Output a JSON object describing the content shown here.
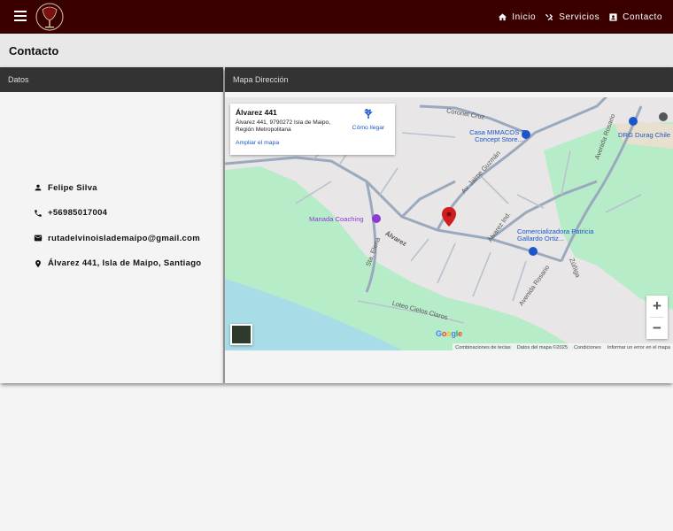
{
  "header": {
    "logo_name": "ruta-del-vino-logo",
    "nav": [
      {
        "label": "Inicio",
        "icon": "home-icon"
      },
      {
        "label": "Servicios",
        "icon": "tools-icon"
      },
      {
        "label": "Contacto",
        "icon": "contact-card-icon"
      }
    ]
  },
  "page": {
    "title": "Contacto"
  },
  "left_panel": {
    "title": "Datos",
    "contacts": [
      {
        "icon": "person-icon",
        "text": "Felipe Silva"
      },
      {
        "icon": "phone-icon",
        "text": "+56985017004"
      },
      {
        "icon": "email-icon",
        "text": "rutadelvinoislademaipo@gmail.com"
      },
      {
        "icon": "location-pin-icon",
        "text": "Álvarez 441, Isla de Maipo, Santiago"
      }
    ]
  },
  "right_panel": {
    "title": "Mapa Dirección",
    "map": {
      "info_title": "Álvarez 441",
      "info_address": "Álvarez 441, 9790272 Isla de Maipo, Región Metropolitana",
      "enlarge_link": "Ampliar el mapa",
      "directions_label": "Cómo llegar",
      "zoom_in": "+",
      "zoom_out": "−",
      "google": "Google",
      "attribution": [
        "Combinaciones de teclas",
        "Datos del mapa ©2025",
        "Condiciones",
        "Informar un error en el mapa"
      ],
      "street_labels": [
        "Coronel Cruz",
        "Av. Jaime Guzmán",
        "Álvarez Ind.",
        "Álvarez",
        "Sta. Elena",
        "Avenida Rosario",
        "Avenida Rosario",
        "Zúñiga",
        "Loteo Cielos Claros"
      ],
      "places": [
        {
          "name": "Casa MIMACOS Tu Concept Store...",
          "color": "#1a57c9"
        },
        {
          "name": "DRG Durag Chile",
          "color": "#1a57c9"
        },
        {
          "name": "Manada Coaching",
          "color": "#8a3bd4"
        },
        {
          "name": "Comercializadora Patricia Gallardo Ortiz...",
          "color": "#1a57c9"
        }
      ]
    }
  },
  "colors": {
    "header_bg": "#3a0000",
    "panel_header_bg": "#333333",
    "link": "#1a57c9",
    "marker": "#d01e1e"
  }
}
